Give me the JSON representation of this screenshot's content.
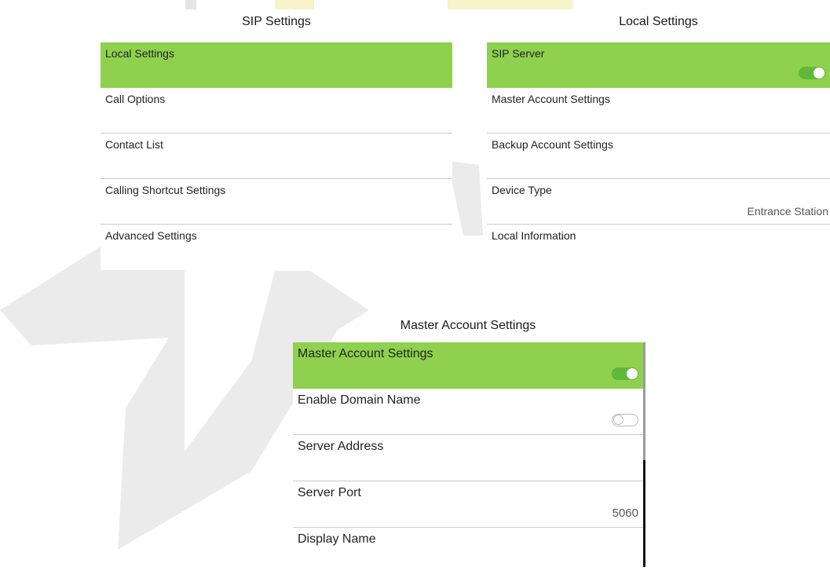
{
  "colors": {
    "accent": "#8fd14f",
    "toggle_on": "#5fb83a",
    "divider": "#cccccc"
  },
  "sip_settings": {
    "title": "SIP Settings",
    "items": [
      {
        "label": "Local Settings",
        "selected": true
      },
      {
        "label": "Call Options"
      },
      {
        "label": "Contact List"
      },
      {
        "label": "Calling Shortcut Settings"
      },
      {
        "label": "Advanced Settings"
      }
    ]
  },
  "local_settings": {
    "title": "Local Settings",
    "items": [
      {
        "label": "SIP Server",
        "selected": true,
        "toggle": "on"
      },
      {
        "label": "Master Account Settings"
      },
      {
        "label": "Backup Account Settings"
      },
      {
        "label": "Device Type",
        "value": "Entrance Station"
      },
      {
        "label": "Local Information"
      }
    ]
  },
  "master_account_settings": {
    "title": "Master Account Settings",
    "items": [
      {
        "label": "Master Account Settings",
        "selected": true,
        "toggle": "on"
      },
      {
        "label": "Enable Domain Name",
        "toggle": "off"
      },
      {
        "label": "Server Address"
      },
      {
        "label": "Server Port",
        "value": "5060"
      },
      {
        "label": "Display Name"
      }
    ]
  }
}
